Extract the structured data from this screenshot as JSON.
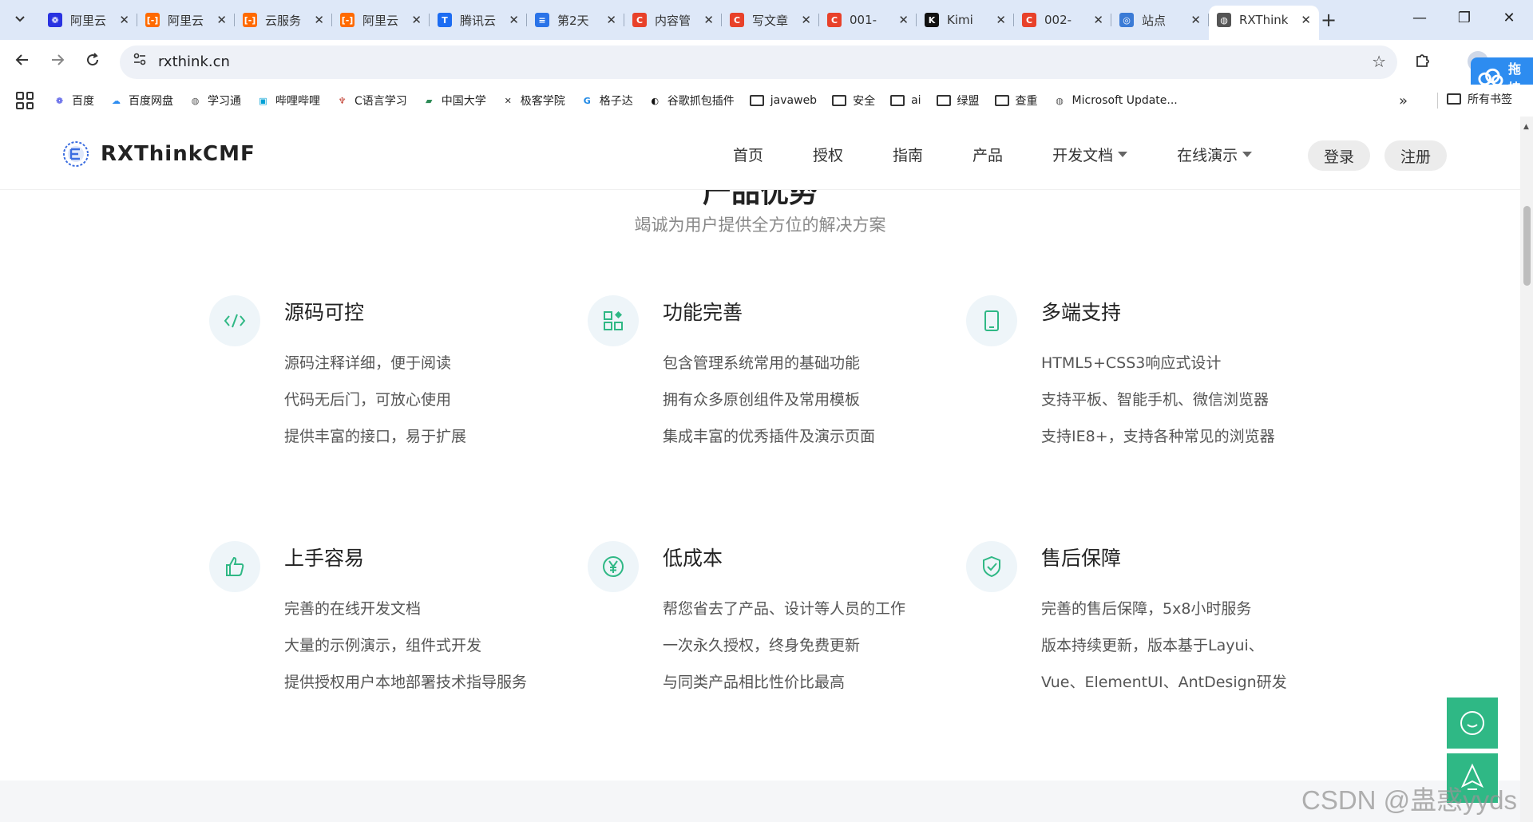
{
  "browser": {
    "tabs": [
      {
        "title": "阿里云",
        "favicon_color": "#2932e1",
        "glyph": "❁",
        "active": false
      },
      {
        "title": "阿里云",
        "favicon_color": "#ff6a00",
        "glyph": "[-]",
        "active": false
      },
      {
        "title": "云服务",
        "favicon_color": "#ff6a00",
        "glyph": "[-]",
        "active": false
      },
      {
        "title": "阿里云",
        "favicon_color": "#ff6a00",
        "glyph": "[-]",
        "active": false
      },
      {
        "title": "腾讯云",
        "favicon_color": "#1c6cf2",
        "glyph": "T",
        "active": false
      },
      {
        "title": "第2天",
        "favicon_color": "#2a73e8",
        "glyph": "≡",
        "active": false
      },
      {
        "title": "内容管",
        "favicon_color": "#e8412a",
        "glyph": "C",
        "active": false
      },
      {
        "title": "写文章",
        "favicon_color": "#e8412a",
        "glyph": "C",
        "active": false
      },
      {
        "title": "001-",
        "favicon_color": "#e8412a",
        "glyph": "C",
        "active": false
      },
      {
        "title": "Kimi",
        "favicon_color": "#111111",
        "glyph": "K",
        "active": false
      },
      {
        "title": "002-",
        "favicon_color": "#e8412a",
        "glyph": "C",
        "active": false
      },
      {
        "title": "站点",
        "favicon_color": "#3b7bd6",
        "glyph": "◎",
        "active": false
      },
      {
        "title": "RXThink",
        "favicon_color": "#555555",
        "glyph": "◍",
        "active": true
      }
    ],
    "tab_close_glyph": "✕",
    "new_tab_glyph": "+",
    "window_controls": {
      "minimize": "—",
      "maximize": "❐",
      "close": "✕"
    },
    "url": "rxthink.cn",
    "extension_badge": "拖拽",
    "bookmarks": [
      {
        "label": "百度",
        "type": "site",
        "color": "#2932e1",
        "glyph": "❁"
      },
      {
        "label": "百度网盘",
        "type": "site",
        "color": "#2d8cf0",
        "glyph": "☁"
      },
      {
        "label": "学习通",
        "type": "site",
        "color": "#555555",
        "glyph": "◍"
      },
      {
        "label": "哔哩哔哩",
        "type": "site",
        "color": "#00a1d6",
        "glyph": "▣"
      },
      {
        "label": "C语言学习",
        "type": "site",
        "color": "#c0392b",
        "glyph": "♆"
      },
      {
        "label": "中国大学",
        "type": "site",
        "color": "#2e8b57",
        "glyph": "▰"
      },
      {
        "label": "极客学院",
        "type": "site",
        "color": "#333333",
        "glyph": "✕"
      },
      {
        "label": "格子达",
        "type": "site",
        "color": "#1e88e5",
        "glyph": "G"
      },
      {
        "label": "谷歌抓包插件",
        "type": "site",
        "color": "#111111",
        "glyph": "◐"
      },
      {
        "label": "javaweb",
        "type": "folder"
      },
      {
        "label": "安全",
        "type": "folder"
      },
      {
        "label": "ai",
        "type": "folder"
      },
      {
        "label": "绿盟",
        "type": "folder"
      },
      {
        "label": "查重",
        "type": "folder"
      },
      {
        "label": "Microsoft Update...",
        "type": "site",
        "color": "#555555",
        "glyph": "◍"
      }
    ],
    "bookmarks_more": "»",
    "all_bookmarks": "所有书签"
  },
  "site": {
    "brand": "RXThinkCMF",
    "nav": [
      {
        "label": "首页",
        "dropdown": false
      },
      {
        "label": "授权",
        "dropdown": false
      },
      {
        "label": "指南",
        "dropdown": false
      },
      {
        "label": "产品",
        "dropdown": false
      },
      {
        "label": "开发文档",
        "dropdown": true
      },
      {
        "label": "在线演示",
        "dropdown": true
      }
    ],
    "login": "登录",
    "register": "注册",
    "section_title": "产品优势",
    "section_subtitle": "竭诚为用户提供全方位的解决方案",
    "features": [
      {
        "title": "源码可控",
        "icon": "code-icon",
        "lines": [
          "源码注释详细，便于阅读",
          "代码无后门，可放心使用",
          "提供丰富的接口，易于扩展"
        ]
      },
      {
        "title": "功能完善",
        "icon": "grid-apps-icon",
        "lines": [
          "包含管理系统常用的基础功能",
          "拥有众多原创组件及常用模板",
          "集成丰富的优秀插件及演示页面"
        ]
      },
      {
        "title": "多端支持",
        "icon": "tablet-icon",
        "lines": [
          "HTML5+CSS3响应式设计",
          "支持平板、智能手机、微信浏览器",
          "支持IE8+，支持各种常见的浏览器"
        ]
      },
      {
        "title": "上手容易",
        "icon": "thumbs-up-icon",
        "lines": [
          "完善的在线开发文档",
          "大量的示例演示，组件式开发",
          "提供授权用户本地部署技术指导服务"
        ]
      },
      {
        "title": "低成本",
        "icon": "yen-coin-icon",
        "lines": [
          "帮您省去了产品、设计等人员的工作",
          "一次永久授权，终身免费更新",
          "与同类产品相比性价比最高"
        ]
      },
      {
        "title": "售后保障",
        "icon": "shield-check-icon",
        "lines": [
          "完善的售后保障，5x8小时服务",
          "版本持续更新，版本基于Layui、",
          "Vue、ElementUI、AntDesign研发"
        ]
      }
    ],
    "accent_color": "#2fb885",
    "icon_bg": "#eef5f9"
  },
  "watermark": "CSDN @蛊惑yyds"
}
